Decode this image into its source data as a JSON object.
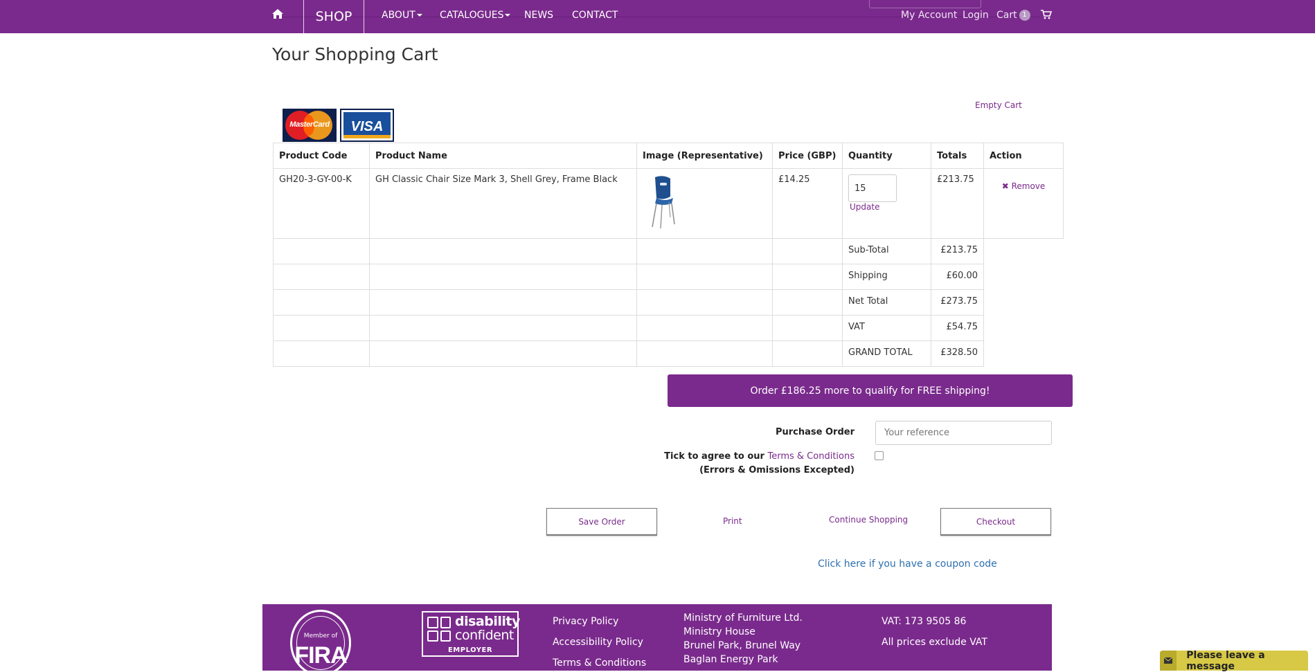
{
  "nav": {
    "shop": "SHOP",
    "about": "ABOUT",
    "catalogues": "CATALOGUES",
    "news": "NEWS",
    "contact": "CONTACT",
    "my_account": "My Account",
    "login": "Login",
    "cart": "Cart",
    "cart_count": "1"
  },
  "page": {
    "title": "Your Shopping Cart",
    "empty_cart": "Empty Cart",
    "card_mastercard": "MasterCard",
    "card_visa": "VISA"
  },
  "table": {
    "headers": [
      "Product Code",
      "Product Name",
      "Image (Representative)",
      "Price (GBP)",
      "Quantity",
      "Totals",
      "Action"
    ],
    "item": {
      "code": "GH20-3-GY-00-K",
      "name": "GH Classic Chair Size Mark 3, Shell Grey, Frame Black",
      "price": "£14.25",
      "quantity": "15",
      "update": "Update",
      "total": "£213.75",
      "remove": "Remove"
    },
    "summary": [
      {
        "label": "Sub-Total",
        "value": "£213.75"
      },
      {
        "label": "Shipping",
        "value": "£60.00"
      },
      {
        "label": "Net Total",
        "value": "£273.75"
      },
      {
        "label": "VAT",
        "value": "£54.75"
      },
      {
        "label": "GRAND TOTAL",
        "value": "£328.50"
      }
    ]
  },
  "shipping_banner": "Order £186.25 more to qualify for FREE shipping!",
  "purchase_order": {
    "label": "Purchase Order",
    "placeholder": "Your reference"
  },
  "terms": {
    "prefix": "Tick to agree to our",
    "link": "Terms & Conditions",
    "note": "(Errors & Omissions Excepted)"
  },
  "actions": {
    "save_order": "Save Order",
    "print": "Print",
    "continue_shopping": "Continue Shopping",
    "checkout": "Checkout",
    "coupon": "Click here if you have a coupon code"
  },
  "footer": {
    "fira_member": "Member of",
    "fira": "FIRA",
    "dc_line1": "disability",
    "dc_line2": "confident",
    "dc_line3": "EMPLOYER",
    "links": [
      "Privacy Policy",
      "Accessibility Policy",
      "Terms & Conditions"
    ],
    "address": [
      "Ministry of Furniture Ltd.",
      "Ministry House",
      "Brunel Park, Brunel Way",
      "Baglan Energy Park"
    ],
    "vat_number": "VAT: 173 9505 86",
    "vat_note": "All prices exclude VAT"
  },
  "chat": {
    "label": "Please leave a message"
  },
  "colors": {
    "brand_purple": "#7a2a8c",
    "link_blue": "#2e6fae",
    "chat_yellow": "#d7c946"
  }
}
